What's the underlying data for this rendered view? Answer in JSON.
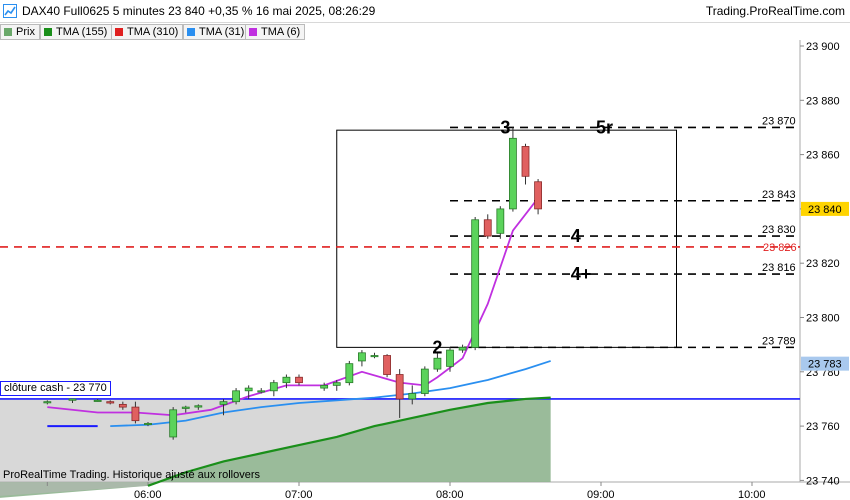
{
  "header": {
    "title": "DAX40 Full0625 5 minutes 23 840 +0,35 % 16 mai 2025, 08:26:29",
    "brand": "Trading.ProRealTime.com"
  },
  "legend": [
    {
      "label": "Prix",
      "color": "#6aa86a"
    },
    {
      "label": "TMA (155)",
      "color": "#1a8f1a"
    },
    {
      "label": "TMA (310)",
      "color": "#e02020"
    },
    {
      "label": "TMA (31)",
      "color": "#2a8ff0"
    },
    {
      "label": "TMA (6)",
      "color": "#c030e0"
    }
  ],
  "footer": "ProRealTime Trading. Historique ajusté aux rollovers",
  "cash_label": "clôture cash -  23 770",
  "chart_data": {
    "type": "candlestick",
    "interval": "5 minutes",
    "y_axis": {
      "ticks": [
        23740,
        23760,
        23780,
        23800,
        23820,
        23840,
        23860,
        23880,
        23900
      ],
      "tick_labels": [
        "23 740",
        "23 760",
        "23 780",
        "23 800",
        "23 820",
        "23 840",
        "23 860",
        "23 880",
        "23 900"
      ],
      "range": [
        23736,
        23915
      ]
    },
    "x_axis": {
      "ticks": [
        "05:20",
        "06:00",
        "07:00",
        "08:00",
        "09:00",
        "10:00"
      ],
      "tick_labels": [
        "",
        "06:00",
        "07:00",
        "08:00",
        "09:00",
        "10:00"
      ],
      "range": [
        "05:20",
        "10:20"
      ]
    },
    "last_price": {
      "value": 23840,
      "label": "23 840"
    },
    "candles": [
      {
        "t": "05:20",
        "o": 23769,
        "h": 23769.5,
        "l": 23768,
        "c": 23769
      },
      {
        "t": "05:30",
        "o": 23769.5,
        "h": 23770,
        "l": 23768.5,
        "c": 23770
      },
      {
        "t": "05:40",
        "o": 23769.5,
        "h": 23770,
        "l": 23769,
        "c": 23769.5
      },
      {
        "t": "05:45",
        "o": 23769,
        "h": 23769.5,
        "l": 23768,
        "c": 23768.5
      },
      {
        "t": "05:50",
        "o": 23768,
        "h": 23769,
        "l": 23766,
        "c": 23767
      },
      {
        "t": "05:55",
        "o": 23767,
        "h": 23769,
        "l": 23761,
        "c": 23762
      },
      {
        "t": "06:00",
        "o": 23761,
        "h": 23761.5,
        "l": 23760,
        "c": 23761
      },
      {
        "t": "06:10",
        "o": 23756,
        "h": 23767,
        "l": 23755,
        "c": 23766
      },
      {
        "t": "06:15",
        "o": 23766.5,
        "h": 23767.5,
        "l": 23765,
        "c": 23767
      },
      {
        "t": "06:20",
        "o": 23767,
        "h": 23768,
        "l": 23766,
        "c": 23767.5
      },
      {
        "t": "06:30",
        "o": 23768,
        "h": 23770,
        "l": 23764,
        "c": 23769
      },
      {
        "t": "06:35",
        "o": 23769,
        "h": 23774,
        "l": 23768,
        "c": 23773
      },
      {
        "t": "06:40",
        "o": 23773,
        "h": 23775,
        "l": 23770,
        "c": 23774
      },
      {
        "t": "06:45",
        "o": 23773,
        "h": 23774,
        "l": 23772,
        "c": 23773
      },
      {
        "t": "06:50",
        "o": 23773,
        "h": 23777,
        "l": 23771,
        "c": 23776
      },
      {
        "t": "06:55",
        "o": 23776,
        "h": 23779,
        "l": 23774,
        "c": 23778
      },
      {
        "t": "07:00",
        "o": 23778,
        "h": 23779,
        "l": 23775,
        "c": 23776
      },
      {
        "t": "07:10",
        "o": 23774,
        "h": 23776,
        "l": 23773,
        "c": 23775
      },
      {
        "t": "07:15",
        "o": 23775,
        "h": 23777,
        "l": 23773,
        "c": 23776
      },
      {
        "t": "07:20",
        "o": 23776,
        "h": 23784,
        "l": 23775,
        "c": 23783
      },
      {
        "t": "07:25",
        "o": 23784,
        "h": 23788,
        "l": 23782,
        "c": 23787
      },
      {
        "t": "07:30",
        "o": 23786,
        "h": 23787,
        "l": 23785,
        "c": 23786
      },
      {
        "t": "07:35",
        "o": 23786,
        "h": 23786.5,
        "l": 23778,
        "c": 23779
      },
      {
        "t": "07:40",
        "o": 23779,
        "h": 23781,
        "l": 23763,
        "c": 23770
      },
      {
        "t": "07:45",
        "o": 23770,
        "h": 23775,
        "l": 23768,
        "c": 23772
      },
      {
        "t": "07:50",
        "o": 23772,
        "h": 23782,
        "l": 23771,
        "c": 23781
      },
      {
        "t": "07:55",
        "o": 23781,
        "h": 23787,
        "l": 23780,
        "c": 23785
      },
      {
        "t": "08:00",
        "o": 23782,
        "h": 23789,
        "l": 23780,
        "c": 23788
      },
      {
        "t": "08:05",
        "o": 23788,
        "h": 23790,
        "l": 23787,
        "c": 23789
      },
      {
        "t": "08:10",
        "o": 23789,
        "h": 23837,
        "l": 23788,
        "c": 23836
      },
      {
        "t": "08:15",
        "o": 23836,
        "h": 23838,
        "l": 23829,
        "c": 23830
      },
      {
        "t": "08:20",
        "o": 23831,
        "h": 23841,
        "l": 23829,
        "c": 23840
      },
      {
        "t": "08:25",
        "o": 23840,
        "h": 23870,
        "l": 23839,
        "c": 23866
      },
      {
        "t": "08:30",
        "o": 23863,
        "h": 23864,
        "l": 23849,
        "c": 23852
      },
      {
        "t": "08:35",
        "o": 23850,
        "h": 23851,
        "l": 23838,
        "c": 23840
      }
    ],
    "series": [
      {
        "name": "TMA (6)",
        "color": "#c030e0",
        "points": [
          [
            "05:20",
            23767
          ],
          [
            "05:40",
            23765
          ],
          [
            "05:55",
            23765
          ],
          [
            "06:10",
            23764
          ],
          [
            "06:25",
            23766
          ],
          [
            "06:40",
            23771
          ],
          [
            "06:55",
            23775
          ],
          [
            "07:10",
            23775
          ],
          [
            "07:25",
            23780
          ],
          [
            "07:40",
            23776
          ],
          [
            "07:50",
            23775
          ],
          [
            "07:55",
            23778
          ],
          [
            "08:05",
            23785
          ],
          [
            "08:15",
            23805
          ],
          [
            "08:25",
            23832
          ],
          [
            "08:35",
            23844
          ]
        ]
      },
      {
        "name": "TMA (31)",
        "color": "#2a8ff0",
        "points": [
          [
            "05:45",
            23760
          ],
          [
            "06:00",
            23760.5
          ],
          [
            "06:15",
            23762
          ],
          [
            "06:30",
            23765
          ],
          [
            "06:45",
            23767
          ],
          [
            "07:00",
            23768.5
          ],
          [
            "07:15",
            23769.5
          ],
          [
            "07:30",
            23770.5
          ],
          [
            "07:45",
            23772
          ],
          [
            "08:00",
            23774
          ],
          [
            "08:15",
            23777
          ],
          [
            "08:30",
            23781
          ],
          [
            "08:40",
            23784
          ]
        ]
      },
      {
        "name": "TMA (155)",
        "color": "#1a8f1a",
        "points": [
          [
            "06:00",
            23738
          ],
          [
            "06:15",
            23743
          ],
          [
            "06:30",
            23747
          ],
          [
            "06:45",
            23750
          ],
          [
            "07:00",
            23753
          ],
          [
            "07:15",
            23756
          ],
          [
            "07:30",
            23760
          ],
          [
            "07:45",
            23763
          ],
          [
            "08:00",
            23766
          ],
          [
            "08:15",
            23768.5
          ],
          [
            "08:30",
            23770
          ],
          [
            "08:40",
            23770.5
          ]
        ]
      },
      {
        "name": "TMA (310)",
        "color": "#e02020",
        "points": [
          [
            "05:20",
            23826
          ],
          [
            "10:20",
            23826
          ]
        ]
      }
    ],
    "blue_series": {
      "color": "#1a1aff",
      "points": [
        [
          "05:20",
          23760
        ],
        [
          "05:40",
          23760
        ]
      ]
    },
    "levels": [
      {
        "value": 23870,
        "label": "23 870",
        "color": "#000",
        "style": "dashed"
      },
      {
        "value": 23843,
        "label": "23 843",
        "color": "#000",
        "style": "dashed"
      },
      {
        "value": 23830,
        "label": "23 830",
        "color": "#000",
        "style": "dashed"
      },
      {
        "value": 23826,
        "label": "23 826",
        "color": "#e02020",
        "style": "dashed"
      },
      {
        "value": 23816,
        "label": "23 816",
        "color": "#000",
        "style": "dashed"
      },
      {
        "value": 23789,
        "label": "23 789",
        "color": "#000",
        "style": "dashed"
      },
      {
        "value": 23770,
        "label": "23 770",
        "color": "#1a1aff",
        "style": "solid"
      }
    ],
    "wave_labels": [
      {
        "text": "2",
        "t": "07:53",
        "y": 23789
      },
      {
        "text": "3",
        "t": "08:20",
        "y": 23870
      },
      {
        "text": "4",
        "t": "08:48",
        "y": 23830
      },
      {
        "text": "4+",
        "t": "08:48",
        "y": 23816
      },
      {
        "text": "5r",
        "t": "08:58",
        "y": 23870
      }
    ],
    "box": {
      "t1": "07:15",
      "t2": "09:30",
      "y1": 23869,
      "y2": 23789
    },
    "value_badges": [
      {
        "value": 23840,
        "label": "23 840",
        "color": "#ffd400",
        "text_color": "#000"
      },
      {
        "value": 23783,
        "label": "23 783",
        "color": "#a9c9ee",
        "text_color": "#000"
      }
    ],
    "dashed_y_labels": [
      {
        "value": 23826,
        "label": "23 826",
        "color": "#e02020"
      }
    ]
  }
}
